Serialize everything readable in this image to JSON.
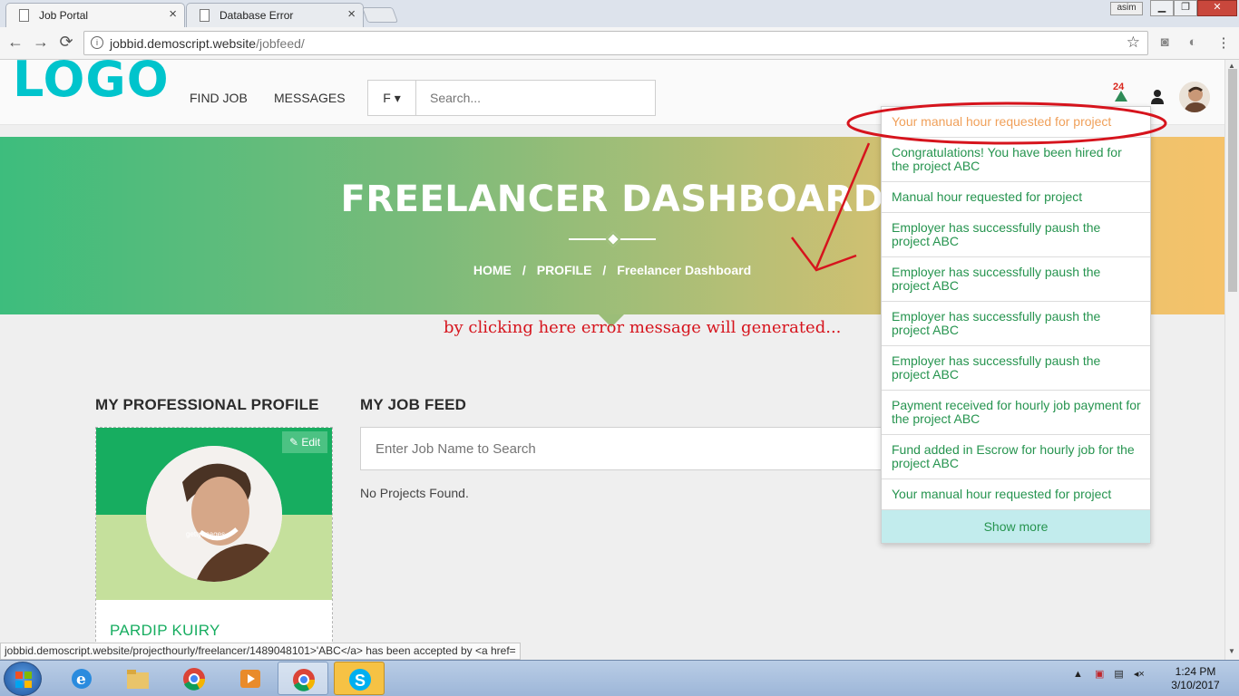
{
  "browser": {
    "tabs": [
      {
        "label": "Job Portal",
        "active": true
      },
      {
        "label": "Database Error",
        "active": false
      }
    ],
    "profile_chip": "asim",
    "url_host": "jobbid.demoscript.website",
    "url_path": "/jobfeed/"
  },
  "header": {
    "logo": "LOGO",
    "nav": [
      "FIND JOB",
      "MESSAGES"
    ],
    "search_filter": "F",
    "search_placeholder": "Search...",
    "notification_count": "24"
  },
  "hero": {
    "title": "FREELANCER DASHBOARD",
    "breadcrumb": [
      "HOME",
      "PROFILE",
      "Freelancer Dashboard"
    ],
    "separator": "/"
  },
  "annotation": {
    "text": "by clicking here error message will generated...",
    "color": "#d6141d"
  },
  "profile": {
    "section_title": "MY PROFESSIONAL PROFILE",
    "edit_label": "Edit",
    "name": "PARDIP KUIRY",
    "photo_watermark": "gettyimages"
  },
  "jobfeed": {
    "section_title": "MY JOB FEED",
    "search_placeholder": "Enter Job Name to Search",
    "empty_text": "No Projects Found."
  },
  "notifications": {
    "items": [
      {
        "text": "Your manual hour requested for project",
        "highlight": true
      },
      {
        "text": "Congratulations! You have been hired for the project ABC"
      },
      {
        "text": "Manual hour requested for project"
      },
      {
        "text": "Employer has successfully paush the project ABC"
      },
      {
        "text": "Employer has successfully paush the project ABC"
      },
      {
        "text": "Employer has successfully paush the project ABC"
      },
      {
        "text": "Employer has successfully paush the project ABC"
      },
      {
        "text": "Payment received for hourly job payment for the project ABC"
      },
      {
        "text": "Fund added in Escrow for hourly job for the project ABC"
      },
      {
        "text": "Your manual hour requested for project"
      }
    ],
    "show_more": "Show more"
  },
  "status_url": "jobbid.demoscript.website/projecthourly/freelancer/1489048101>'ABC</a> has been accepted by <a href=",
  "taskbar": {
    "time": "1:24 PM",
    "date": "3/10/2017"
  },
  "colors": {
    "brand": "#00c4cc",
    "green": "#17ad60",
    "notif_text": "#26944f",
    "highlight": "#f0a05a"
  }
}
